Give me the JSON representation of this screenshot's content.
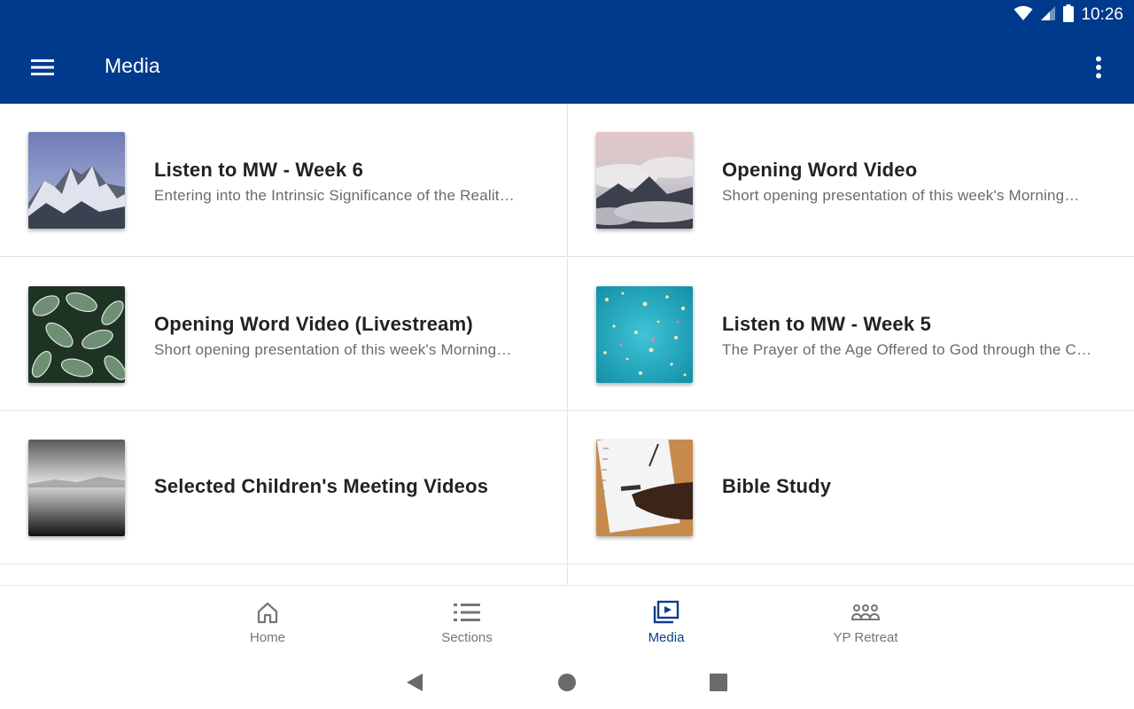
{
  "status_bar": {
    "time": "10:26",
    "icons": [
      "wifi-icon",
      "signal-icon",
      "battery-icon"
    ]
  },
  "app_bar": {
    "title": "Media",
    "menu_icon": "hamburger-menu-icon",
    "overflow_icon": "more-vert-icon",
    "background": "#003a8c"
  },
  "media_items": [
    {
      "title": "Listen to MW - Week 6",
      "subtitle": "Entering into the Intrinsic Significance of the Realit…",
      "thumbnail": "snowy-mountain-image"
    },
    {
      "title": "Opening Word Video",
      "subtitle": "Short opening presentation of this week's Morning…",
      "thumbnail": "mountain-clouds-image"
    },
    {
      "title": "Opening Word Video (Livestream)",
      "subtitle": "Short opening presentation of this week's Morning…",
      "thumbnail": "green-leaves-image"
    },
    {
      "title": "Listen to MW - Week 5",
      "subtitle": "The Prayer of the Age Offered to God through the C…",
      "thumbnail": "turquoise-confetti-image"
    },
    {
      "title": "Selected Children's Meeting Videos",
      "subtitle": "",
      "thumbnail": "grey-sea-image"
    },
    {
      "title": "Bible Study",
      "subtitle": "",
      "thumbnail": "notebook-writing-image"
    }
  ],
  "bottom_nav": {
    "items": [
      {
        "label": "Home",
        "icon": "home-icon"
      },
      {
        "label": "Sections",
        "icon": "list-icon"
      },
      {
        "label": "Media",
        "icon": "video-library-icon",
        "active": true
      },
      {
        "label": "YP Retreat",
        "icon": "group-icon"
      }
    ],
    "active_color": "#0b3d91"
  },
  "system_nav": {
    "buttons": [
      "back-icon",
      "home-circle-icon",
      "recents-square-icon"
    ]
  }
}
